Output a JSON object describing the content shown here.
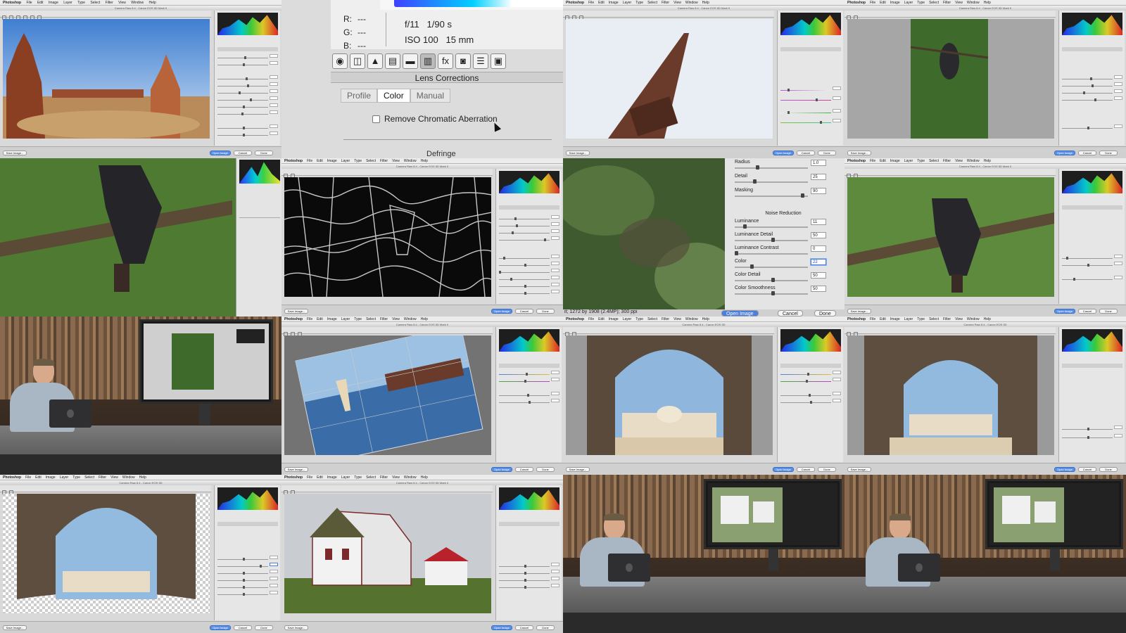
{
  "menubar": {
    "app": "Photoshop",
    "items": [
      "File",
      "Edit",
      "Image",
      "Layer",
      "Type",
      "Select",
      "Filter",
      "View",
      "Window",
      "Help"
    ]
  },
  "window_titles": {
    "canon5d_mk2": "Camera Raw 8.4 - Canon EOS 5D Mark II",
    "canon5d": "Camera Raw 8.4 - Canon EOS 5D"
  },
  "buttons": {
    "save_image": "Save Image...",
    "open_image": "Open Image",
    "cancel": "Cancel",
    "done": "Done"
  },
  "lens_zoom": {
    "rgb": [
      "R:",
      "G:",
      "B:"
    ],
    "rgb_values": [
      "---",
      "---",
      "---"
    ],
    "aperture_shutter": "f/11   1/90 s",
    "iso_focal": "ISO 100   15 mm",
    "tools": [
      "◉",
      "◫",
      "▲",
      "▤",
      "▬",
      "▥",
      "fx",
      "◙",
      "☰",
      "▣"
    ],
    "panel_title": "Lens Corrections",
    "tabs": [
      "Profile",
      "Color",
      "Manual"
    ],
    "active_tab": "Color",
    "checkbox_label": "Remove Chromatic Aberration",
    "next_section": "Defringe"
  },
  "detail_zoom": {
    "sliders_top": [
      {
        "label": "Radius",
        "value": "1.0",
        "level": 0.3
      },
      {
        "label": "Detail",
        "value": "25",
        "level": 0.25
      },
      {
        "label": "Masking",
        "value": "90",
        "level": 0.9
      }
    ],
    "noise_heading": "Noise Reduction",
    "sliders_noise": [
      {
        "label": "Luminance",
        "value": "11",
        "level": 0.11
      },
      {
        "label": "Luminance Detail",
        "value": "50",
        "level": 0.5
      },
      {
        "label": "Luminance Contrast",
        "value": "0",
        "level": 0.0
      },
      {
        "label": "Color",
        "value": "22",
        "level": 0.22
      },
      {
        "label": "Color Detail",
        "value": "50",
        "level": 0.5
      },
      {
        "label": "Color Smoothness",
        "value": "50",
        "level": 0.5
      }
    ],
    "footer_dims": "it; 1272 by 1908 (2.4MP); 300 ppi"
  },
  "colors": {
    "primary_button": "#4a7fe0",
    "link_blue": "#2146c4",
    "panel_bg": "#e6e6e6"
  }
}
